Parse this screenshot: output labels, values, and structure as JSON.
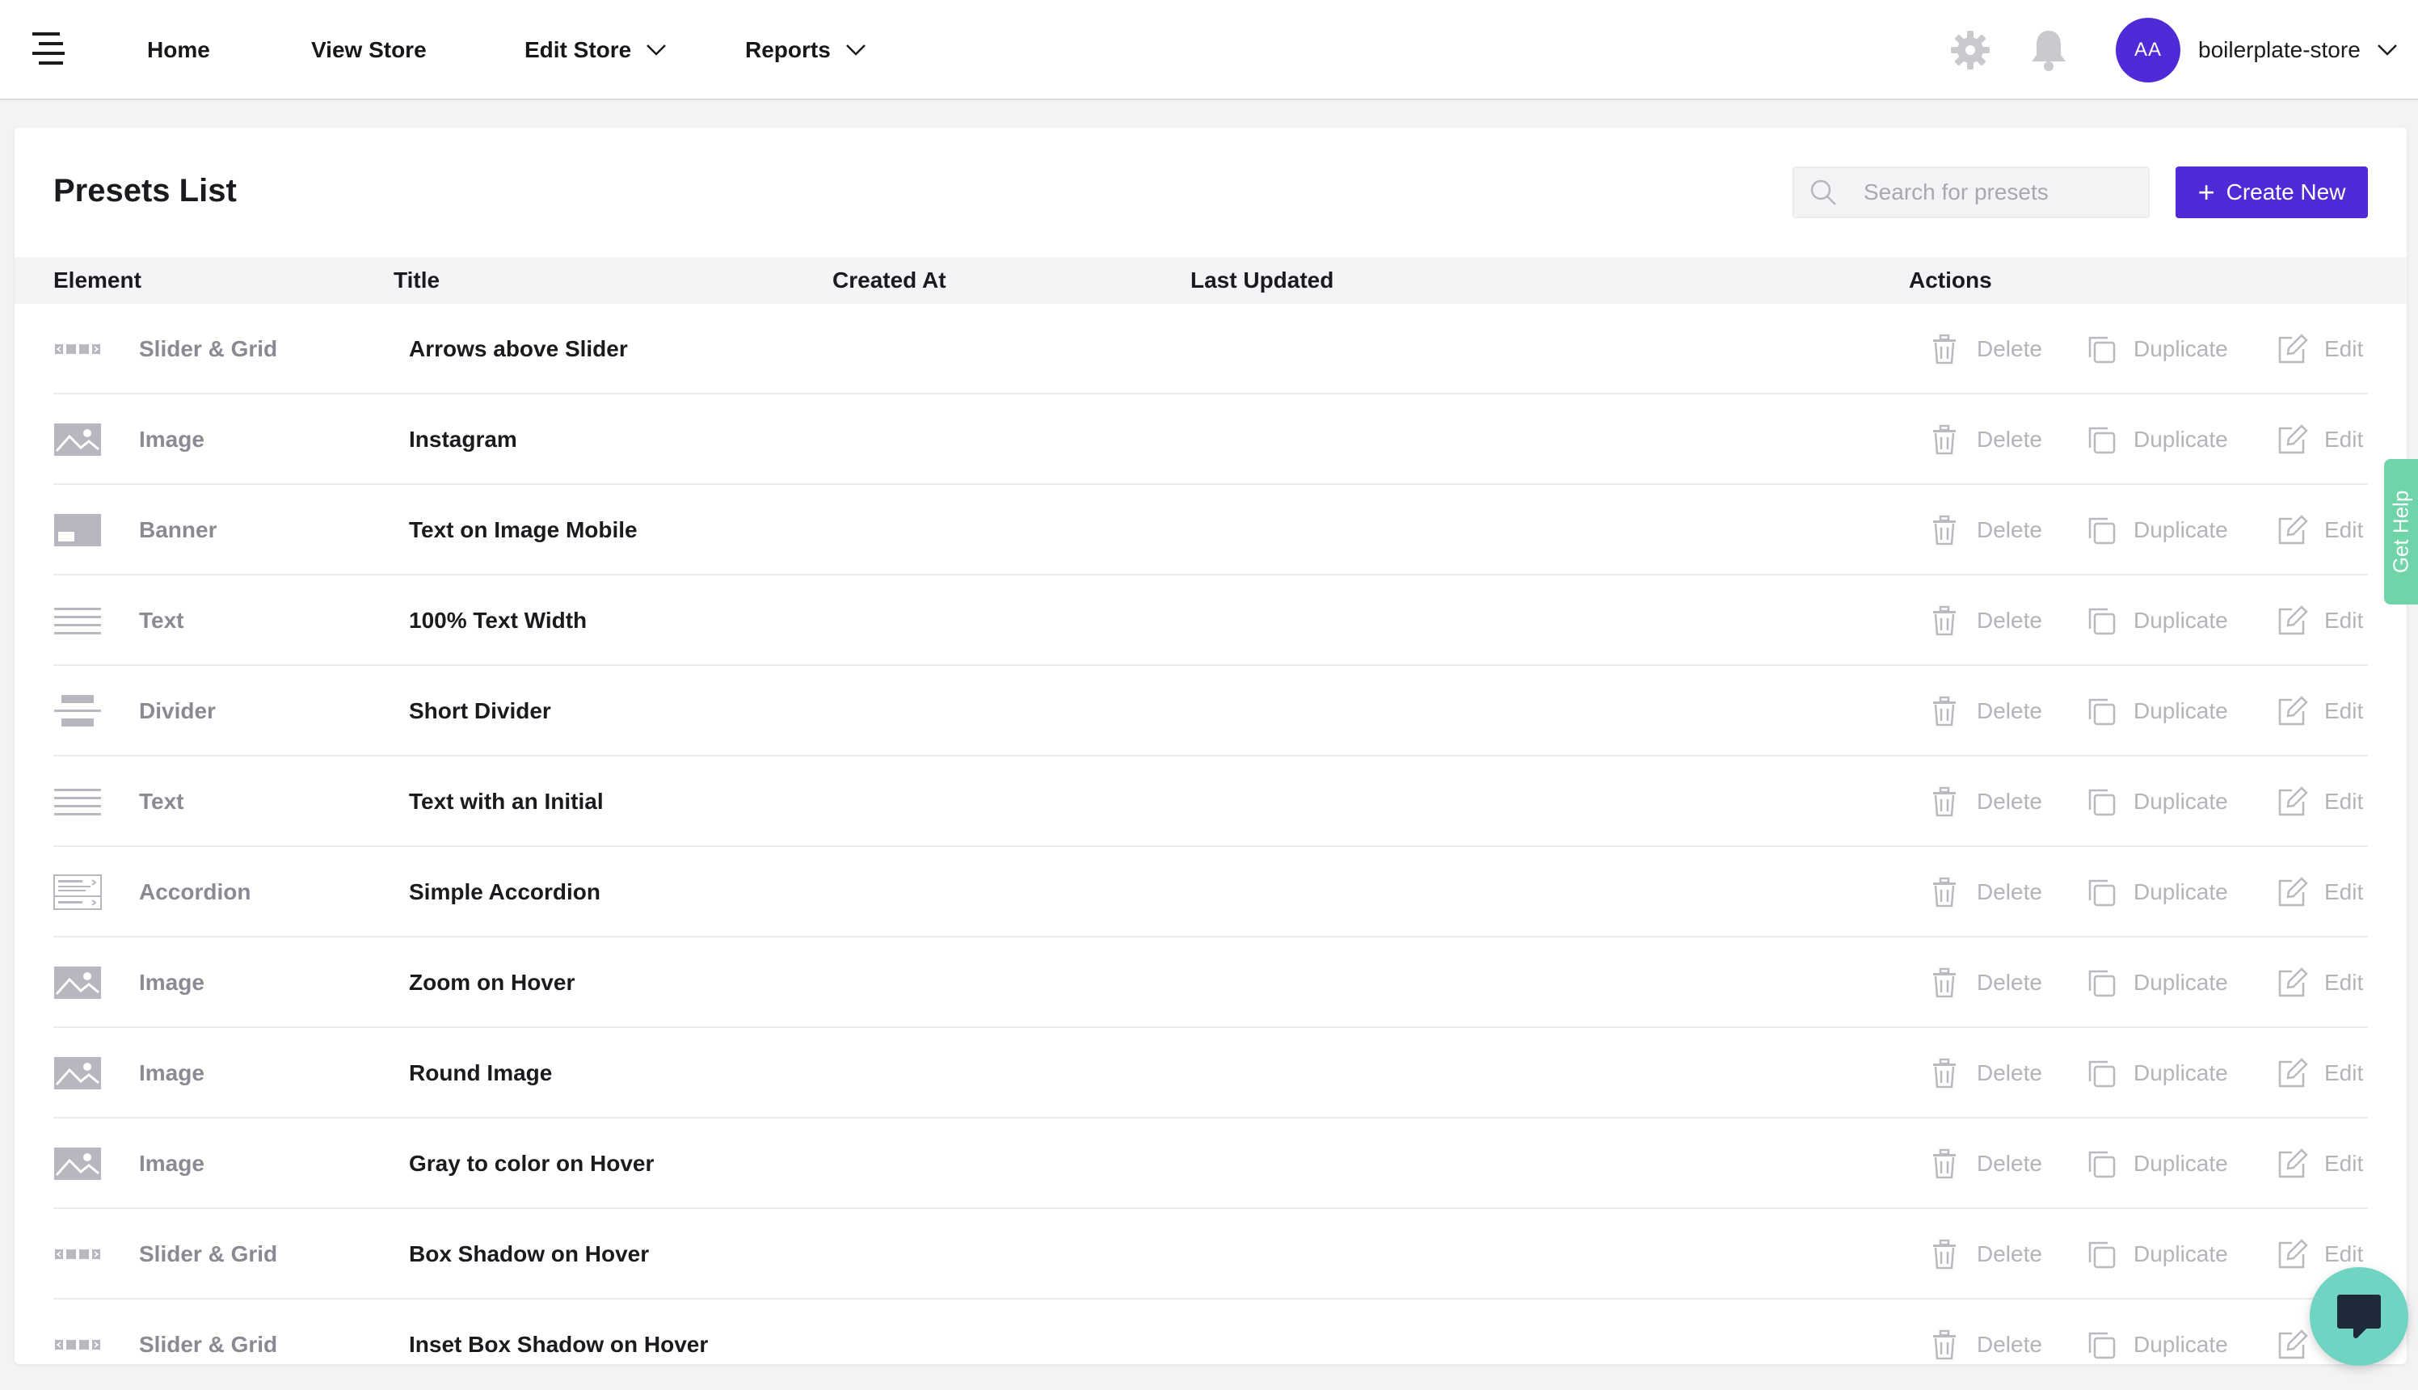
{
  "nav": {
    "home": "Home",
    "view_store": "View Store",
    "edit_store": "Edit Store",
    "reports": "Reports"
  },
  "user": {
    "initials": "AA",
    "store": "boilerplate-store",
    "avatar_color": "#4f2ad6"
  },
  "page": {
    "title": "Presets List",
    "search_placeholder": "Search for presets",
    "create_label": "Create New",
    "accent_color": "#4f2ad6"
  },
  "table": {
    "headers": {
      "element": "Element",
      "title": "Title",
      "created_at": "Created At",
      "last_updated": "Last Updated",
      "actions": "Actions"
    },
    "action_labels": {
      "delete": "Delete",
      "duplicate": "Duplicate",
      "edit": "Edit"
    },
    "rows": [
      {
        "element": "Slider & Grid",
        "icon": "slider-grid-icon",
        "title": "Arrows above Slider"
      },
      {
        "element": "Image",
        "icon": "image-icon",
        "title": "Instagram"
      },
      {
        "element": "Banner",
        "icon": "banner-icon",
        "title": "Text on Image Mobile"
      },
      {
        "element": "Text",
        "icon": "text-lines-icon",
        "title": "100% Text Width"
      },
      {
        "element": "Divider",
        "icon": "divider-icon",
        "title": "Short Divider"
      },
      {
        "element": "Text",
        "icon": "text-lines-icon",
        "title": "Text with an Initial"
      },
      {
        "element": "Accordion",
        "icon": "accordion-icon",
        "title": "Simple Accordion"
      },
      {
        "element": "Image",
        "icon": "image-icon",
        "title": "Zoom on Hover"
      },
      {
        "element": "Image",
        "icon": "image-icon",
        "title": "Round Image"
      },
      {
        "element": "Image",
        "icon": "image-icon",
        "title": "Gray to color on Hover"
      },
      {
        "element": "Slider & Grid",
        "icon": "slider-grid-icon",
        "title": "Box Shadow on Hover"
      },
      {
        "element": "Slider & Grid",
        "icon": "slider-grid-icon",
        "title": "Inset Box Shadow on Hover"
      }
    ]
  },
  "help_tab": "Get Help",
  "help_color": "#6fd5a8"
}
